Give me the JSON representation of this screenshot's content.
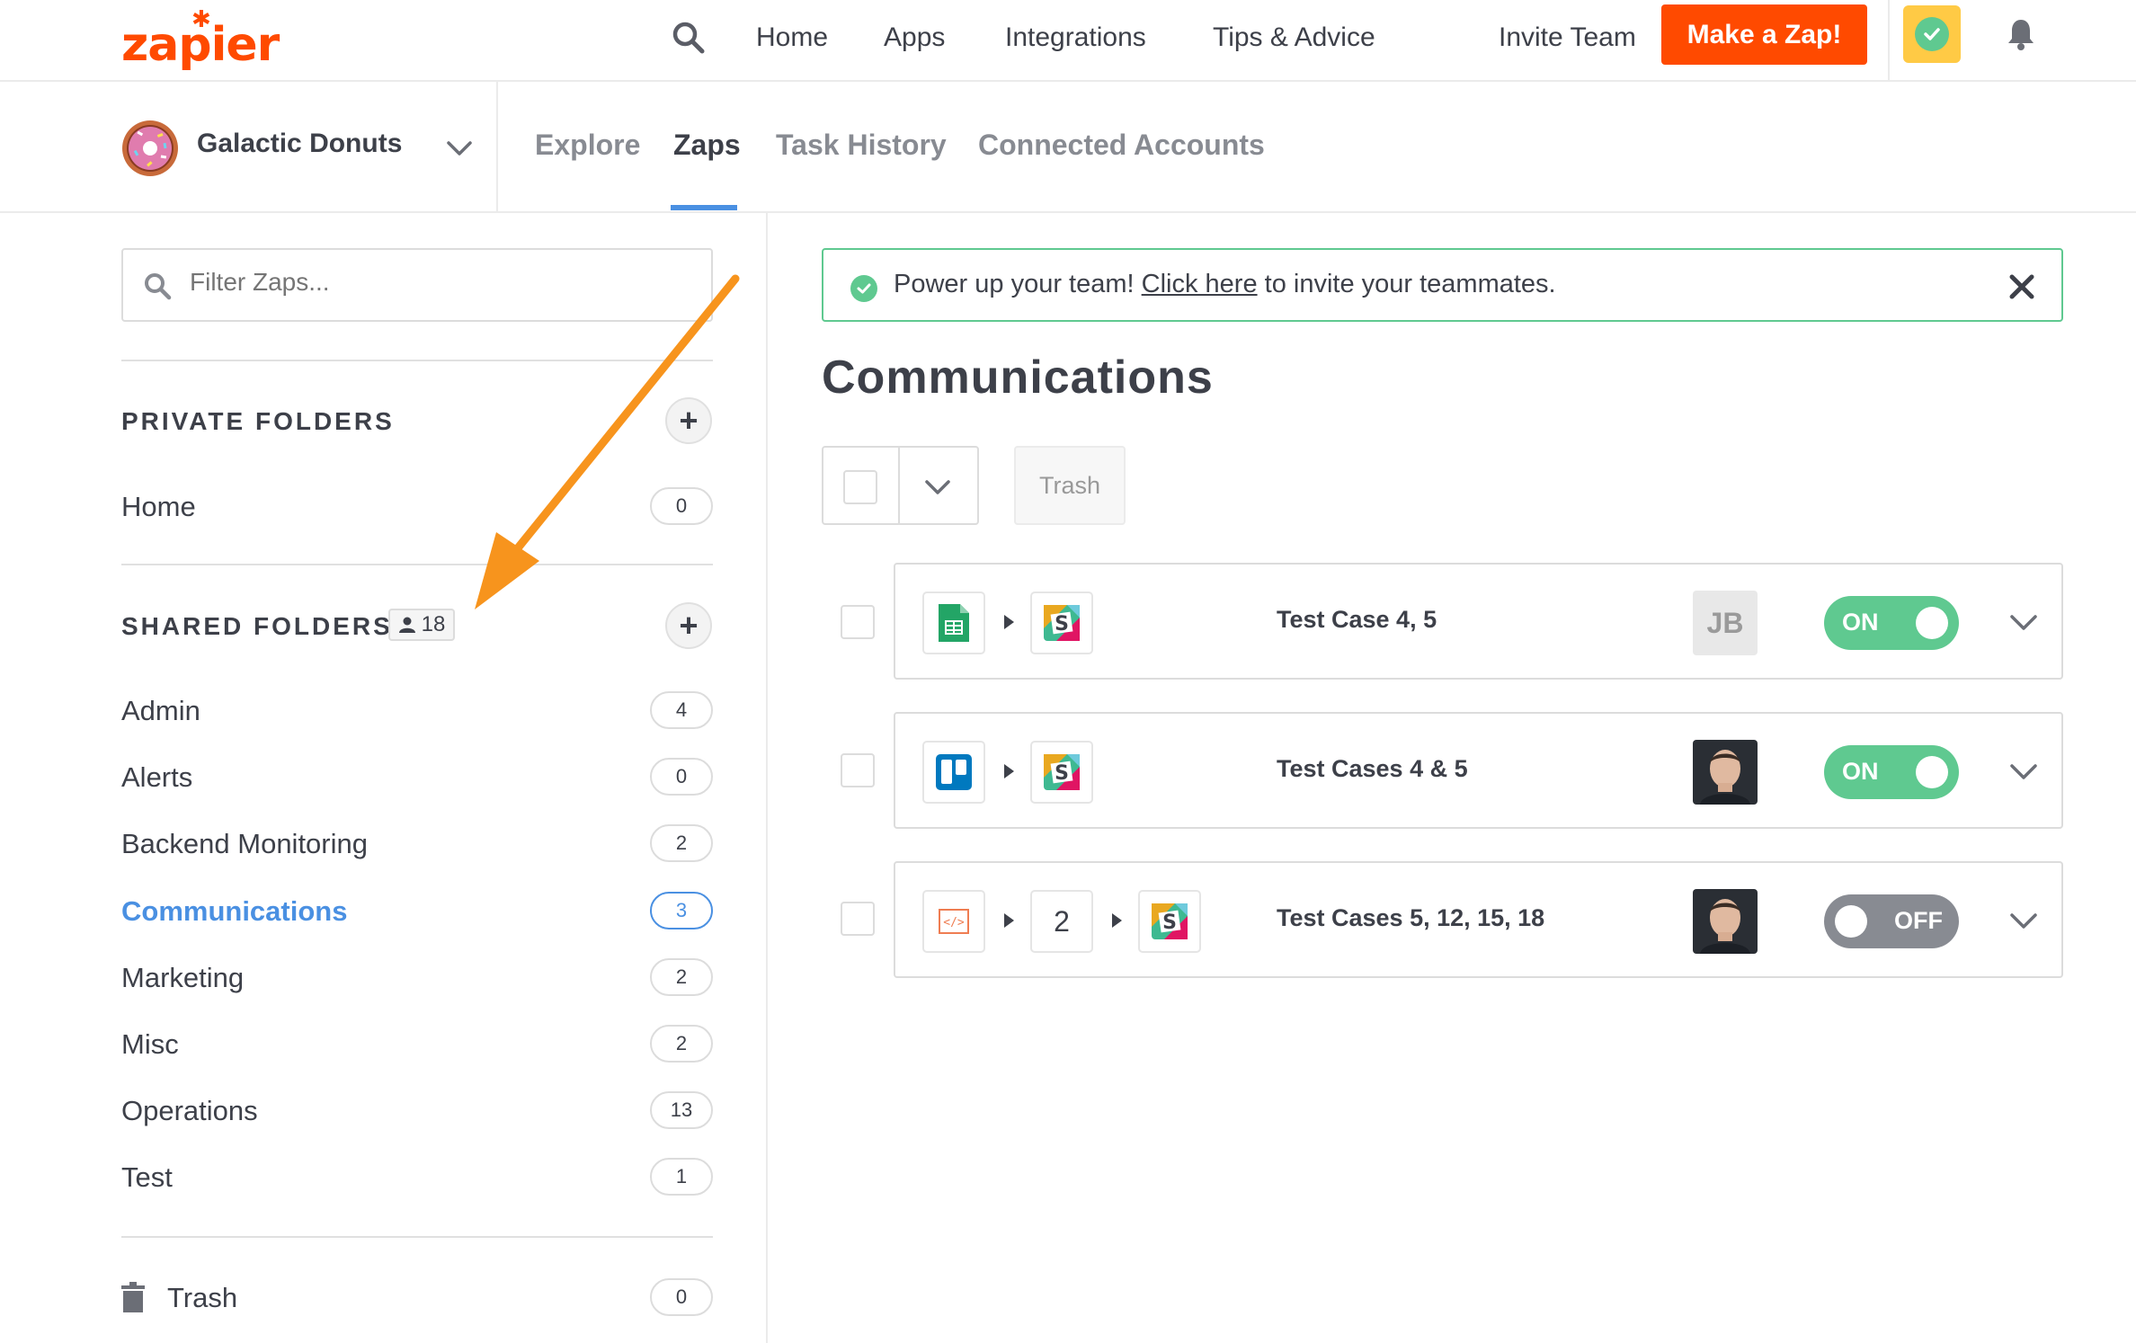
{
  "nav": {
    "logo": "zapier",
    "links": [
      "Home",
      "Apps",
      "Integrations",
      "Tips & Advice",
      "Invite Team"
    ],
    "make_zap": "Make a Zap!",
    "search_icon": "search-icon",
    "bell_icon": "bell-icon"
  },
  "account": {
    "name": "Galactic Donuts"
  },
  "tabs": [
    "Explore",
    "Zaps",
    "Task History",
    "Connected Accounts"
  ],
  "active_tab": "Zaps",
  "sidebar": {
    "filter_placeholder": "Filter Zaps...",
    "private_title": "PRIVATE FOLDERS",
    "private_folders": [
      {
        "label": "Home",
        "count": "0"
      }
    ],
    "shared_title": "SHARED FOLDERS",
    "shared_member_count": "18",
    "shared_folders": [
      {
        "label": "Admin",
        "count": "4"
      },
      {
        "label": "Alerts",
        "count": "0"
      },
      {
        "label": "Backend Monitoring",
        "count": "2"
      },
      {
        "label": "Communications",
        "count": "3"
      },
      {
        "label": "Marketing",
        "count": "2"
      },
      {
        "label": "Misc",
        "count": "2"
      },
      {
        "label": "Operations",
        "count": "13"
      },
      {
        "label": "Test",
        "count": "1"
      }
    ],
    "active_folder": "Communications",
    "trash": {
      "label": "Trash",
      "count": "0"
    }
  },
  "banner": {
    "before": "Power up your team!",
    "link": "Click here",
    "after": "to invite your teammates."
  },
  "main": {
    "title": "Communications",
    "trash_button": "Trash",
    "zaps": [
      {
        "name": "Test Case 4, 5",
        "apps": [
          "google-sheets-icon",
          "slack-icon"
        ],
        "owner": "JB",
        "status": "ON"
      },
      {
        "name": "Test Cases 4 & 5",
        "apps": [
          "trello-icon",
          "slack-icon"
        ],
        "owner": "avatar-photo",
        "status": "ON"
      },
      {
        "name": "Test Cases 5, 12, 15, 18",
        "apps": [
          "code-icon",
          "slack-icon"
        ],
        "middle_steps": "2",
        "owner": "avatar-photo",
        "status": "OFF"
      }
    ]
  },
  "colors": {
    "brand": "#ff4a00",
    "accent": "#4a90e2",
    "success": "#5fc990",
    "annotation_arrow": "#f7941d"
  }
}
